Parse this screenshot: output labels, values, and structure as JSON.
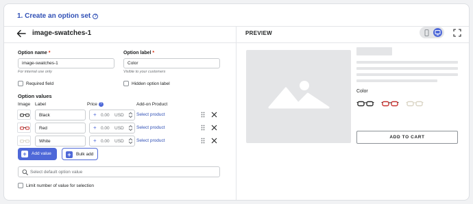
{
  "header": {
    "step_title": "1. Create an option set",
    "help_icon": "question-circle-icon"
  },
  "editor": {
    "title": "image-swatches-1",
    "back_icon": "arrow-left-icon",
    "option_name": {
      "label": "Option name",
      "required_mark": "*",
      "value": "image-swatches-1",
      "help": "For internal use only"
    },
    "option_label": {
      "label": "Option label",
      "required_mark": "*",
      "value": "Color",
      "help": "Visible to your customers"
    },
    "required_field": {
      "label": "Required field",
      "checked": false
    },
    "hidden_label": {
      "label": "Hidden option label",
      "checked": false
    },
    "values_section": {
      "title": "Option values",
      "columns": {
        "image": "Image",
        "label": "Label",
        "price": "Price",
        "addon": "Add-on Product"
      },
      "rows": [
        {
          "label": "Black",
          "price_sign": "+",
          "price": "0.00",
          "currency": "USD",
          "addon_link": "Select product",
          "swatch_color": "#2b2b2b"
        },
        {
          "label": "Red",
          "price_sign": "+",
          "price": "0.00",
          "currency": "USD",
          "addon_link": "Select product",
          "swatch_color": "#c8312f"
        },
        {
          "label": "White",
          "price_sign": "+",
          "price": "0.00",
          "currency": "USD",
          "addon_link": "Select product",
          "swatch_color": "#e6e2d6"
        }
      ]
    },
    "buttons": {
      "add_value": "Add value",
      "bulk_add": "Bulk add"
    },
    "default_search_placeholder": "Select default option value",
    "limit_checkbox": {
      "label": "Limit number of value for selection",
      "checked": false
    }
  },
  "preview": {
    "title": "PREVIEW",
    "device_toggle": {
      "mobile_icon": "mobile-icon",
      "desktop_icon": "desktop-icon",
      "active": "desktop"
    },
    "expand_icon": "expand-icon",
    "image_placeholder_icon": "image-placeholder-icon",
    "color_label": "Color",
    "swatches": [
      "#2b2b2b",
      "#c8312f",
      "#e6e2d6"
    ],
    "add_to_cart": "ADD TO CART"
  },
  "colors": {
    "accent": "#4e68d8",
    "link": "#2f4fb5",
    "required": "#d82c0d"
  }
}
